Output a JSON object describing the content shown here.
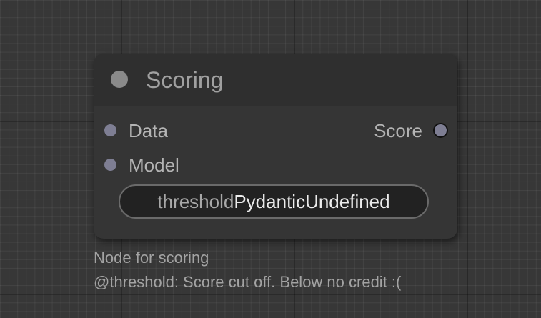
{
  "node": {
    "title": "Scoring",
    "inputs": [
      {
        "label": "Data"
      },
      {
        "label": "Model"
      }
    ],
    "outputs": [
      {
        "label": "Score"
      }
    ],
    "widget": {
      "name": "threshold",
      "value": "PydanticUndefined"
    }
  },
  "description": {
    "line1": "Node for scoring",
    "line2": "@threshold: Score cut off. Below no credit :("
  },
  "colors": {
    "canvas_bg": "#373737",
    "node_body": "#353535",
    "node_header": "#2f2f2f",
    "slot_color": "#7e7e93",
    "widget_bg": "#222222"
  }
}
